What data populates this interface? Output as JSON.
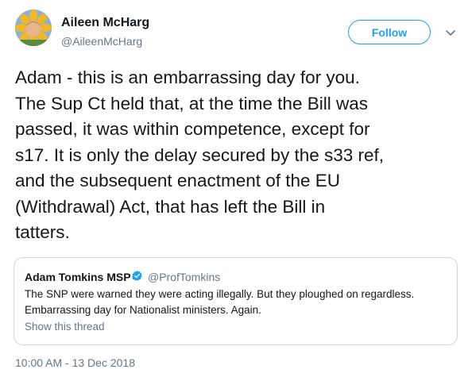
{
  "author": {
    "name": "Aileen McHarg",
    "handle": "@AileenMcHarg",
    "avatar_icon": "sunflower-avatar"
  },
  "follow_label": "Follow",
  "more_icon": "chevron-down-icon",
  "tweet_lines": [
    "Adam - this is an embarrassing day for you.",
    "The Sup Ct held that, at the time the Bill was",
    "passed, it was within competence, except for",
    "s17. It is only the delay secured by the s33 ref,",
    "and the subsequent enactment of the EU",
    "(Withdrawal) Act, that has left the Bill in",
    "tatters."
  ],
  "quoted": {
    "name": "Adam Tomkins MSP",
    "verified_icon": "verified-badge-icon",
    "handle": "@ProfTomkins",
    "text_lines": [
      "The SNP were warned they were acting illegally. But they ploughed on regardless.",
      "Embarrassing day for Nationalist ministers. Again."
    ],
    "show_thread": "Show this thread"
  },
  "timestamp": "10:00 AM - 13 Dec 2018",
  "colors": {
    "accent": "#1da1f2",
    "text": "#14171a",
    "muted": "#657786",
    "border": "#ccd6dd"
  }
}
